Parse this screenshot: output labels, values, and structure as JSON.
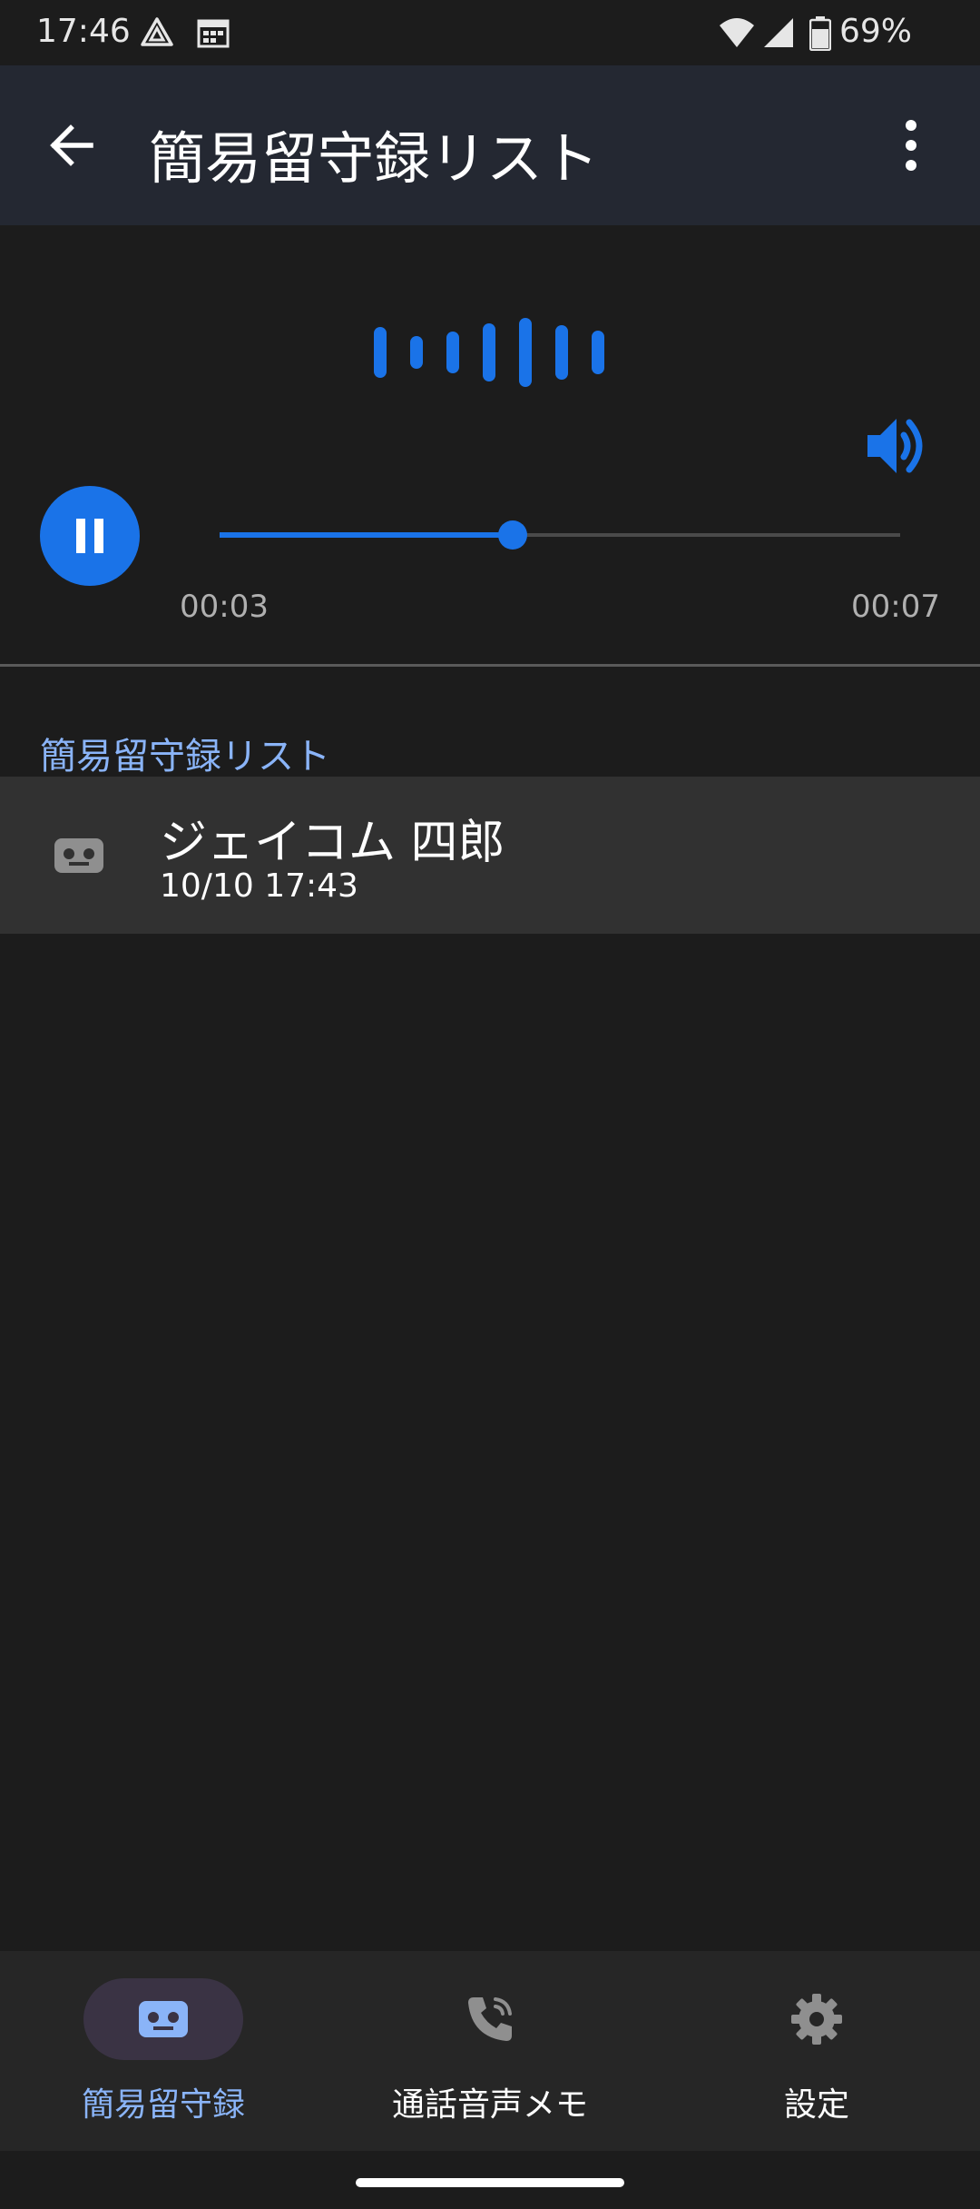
{
  "status_bar": {
    "time": "17:46",
    "battery_percent": "69%",
    "icons": [
      "drive-icon",
      "calendar-icon",
      "wifi-icon",
      "signal-icon",
      "battery-icon"
    ]
  },
  "app_bar": {
    "title": "簡易留守録リスト",
    "back_icon": "arrow-left-icon",
    "menu_icon": "more-vert-icon",
    "background": "#242832"
  },
  "player": {
    "current_time": "00:03",
    "total_time": "00:07",
    "progress": 0.43,
    "state": "playing",
    "accent": "#1a73e8"
  },
  "list": {
    "section_title": "簡易留守録リスト",
    "items": [
      {
        "name": "ジェイコム 四郎",
        "datetime": "10/10 17:43",
        "icon": "voicemail-icon"
      }
    ]
  },
  "bottom_nav": {
    "items": [
      {
        "label": "簡易留守録",
        "icon": "voicemail-icon",
        "active": true
      },
      {
        "label": "通話音声メモ",
        "icon": "phone-record-icon",
        "active": false
      },
      {
        "label": "設定",
        "icon": "gear-icon",
        "active": false
      }
    ],
    "active_color": "#8ab4f8"
  }
}
